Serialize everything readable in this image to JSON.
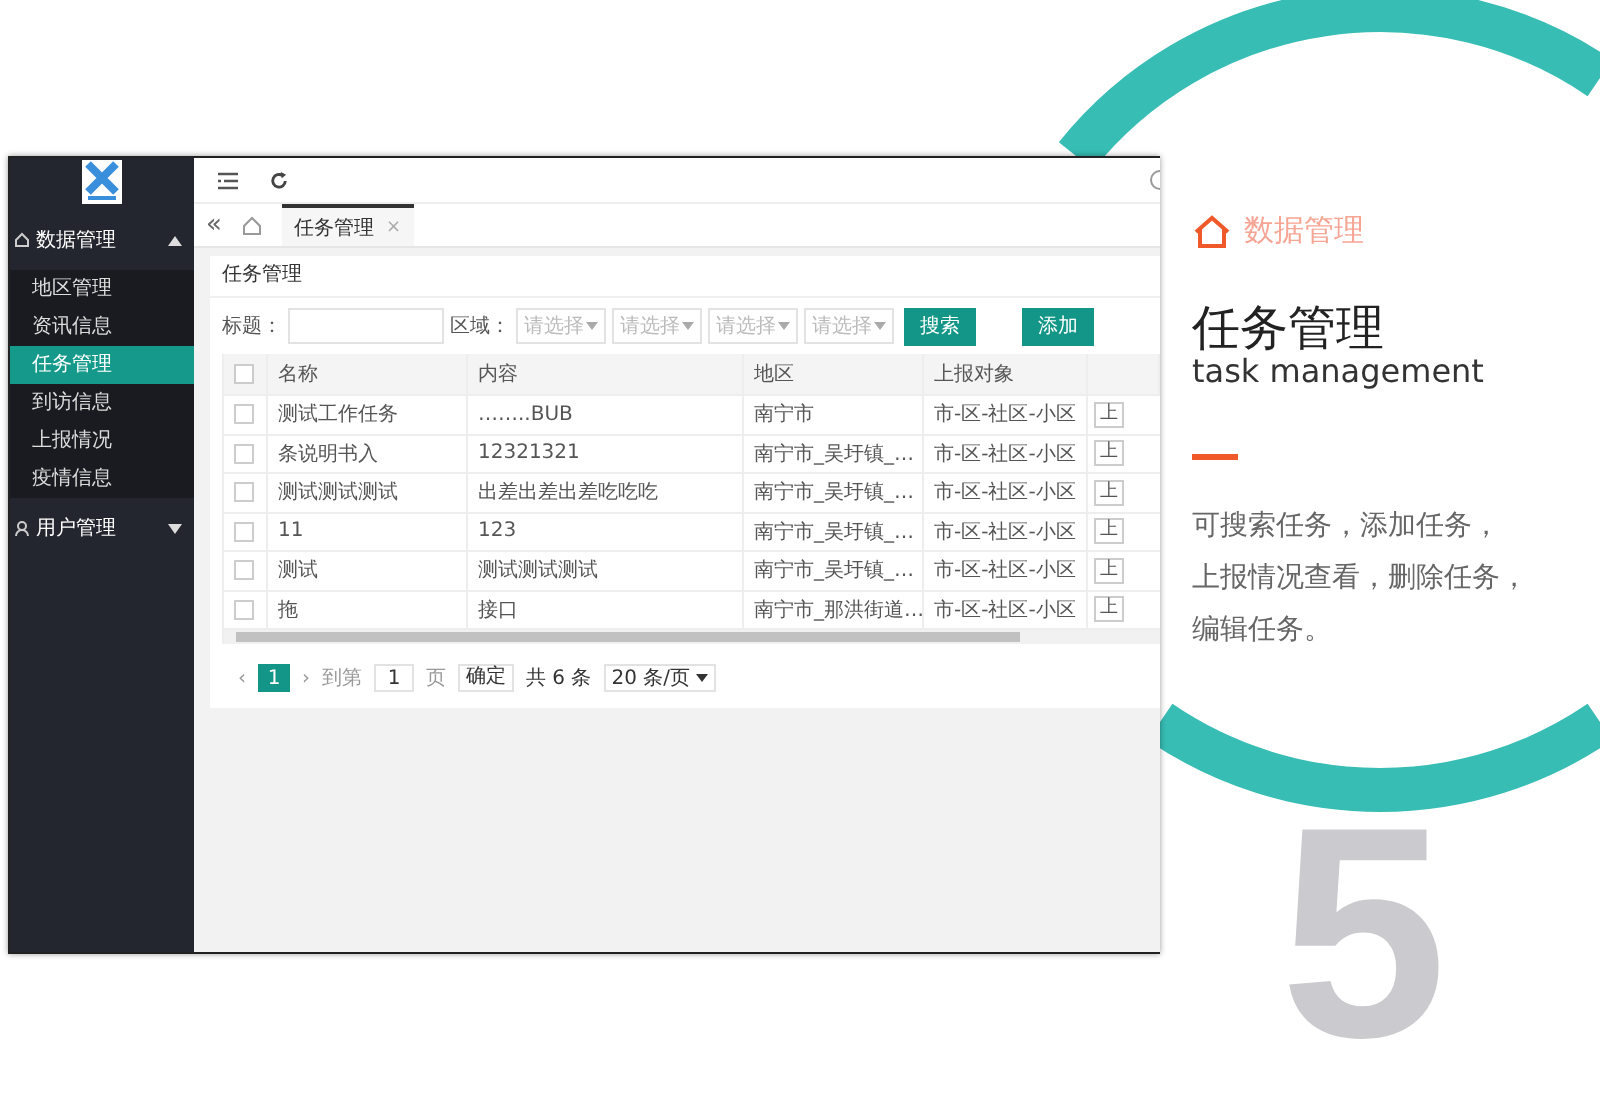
{
  "window": {
    "sidebar": {
      "groups": [
        {
          "label": "数据管理",
          "expanded": true,
          "children": [
            {
              "label": "地区管理",
              "selected": false
            },
            {
              "label": "资讯信息",
              "selected": false
            },
            {
              "label": "任务管理",
              "selected": true
            },
            {
              "label": "到访信息",
              "selected": false
            },
            {
              "label": "上报情况",
              "selected": false
            },
            {
              "label": "疫情信息",
              "selected": false
            }
          ]
        },
        {
          "label": "用户管理",
          "expanded": false
        }
      ]
    },
    "nav": {
      "collapse": "«"
    },
    "tabs": [
      {
        "label": "任务管理",
        "close": "×",
        "selected": true
      }
    ],
    "card": {
      "title": "任务管理",
      "filters": {
        "title_label": "标题：",
        "region_label": "区域：",
        "region_selects": [
          {
            "placeholder": "请选择"
          },
          {
            "placeholder": "请选择"
          },
          {
            "placeholder": "请选择"
          },
          {
            "placeholder": "请选择"
          }
        ],
        "search_button": "搜索",
        "add_button": "添加"
      },
      "table": {
        "header_checked": false,
        "columns": [
          "名称",
          "内容",
          "地区",
          "上报对象"
        ],
        "rows": [
          {
            "checked": false,
            "cells": [
              "测试工作任务",
              "……..BUB",
              "南宁市",
              "市-区-社区-小区"
            ],
            "action": "上"
          },
          {
            "checked": false,
            "cells": [
              "条说明书入",
              "12321321",
              "南宁市_吴圩镇_…",
              "市-区-社区-小区"
            ],
            "action": "上"
          },
          {
            "checked": false,
            "cells": [
              "测试测试测试",
              "出差出差出差吃吃吃",
              "南宁市_吴圩镇_…",
              "市-区-社区-小区"
            ],
            "action": "上"
          },
          {
            "checked": false,
            "cells": [
              "11",
              "123",
              "南宁市_吴圩镇_…",
              "市-区-社区-小区"
            ],
            "action": "上"
          },
          {
            "checked": false,
            "cells": [
              "测试",
              "测试测试测试",
              "南宁市_吴圩镇_…",
              "市-区-社区-小区"
            ],
            "action": "上"
          },
          {
            "checked": false,
            "cells": [
              "拖",
              "接口",
              "南宁市_那洪街道…",
              "市-区-社区-小区"
            ],
            "action": "上"
          }
        ]
      },
      "pagination": {
        "prev": "‹",
        "pages": [
          {
            "label": "1",
            "selected": true
          }
        ],
        "next": "›",
        "goto_label": "到第",
        "goto_value": "1",
        "page_unit": "页",
        "confirm": "确定",
        "total": "共 6 条",
        "page_size": "20 条/页"
      }
    }
  },
  "panel": {
    "category": "数据管理",
    "title": "任务管理",
    "subtitle": "task management",
    "description_lines": [
      "可搜索任务，添加任务，",
      "上报情况查看，删除任务，",
      "编辑任务。"
    ]
  },
  "number": "5"
}
